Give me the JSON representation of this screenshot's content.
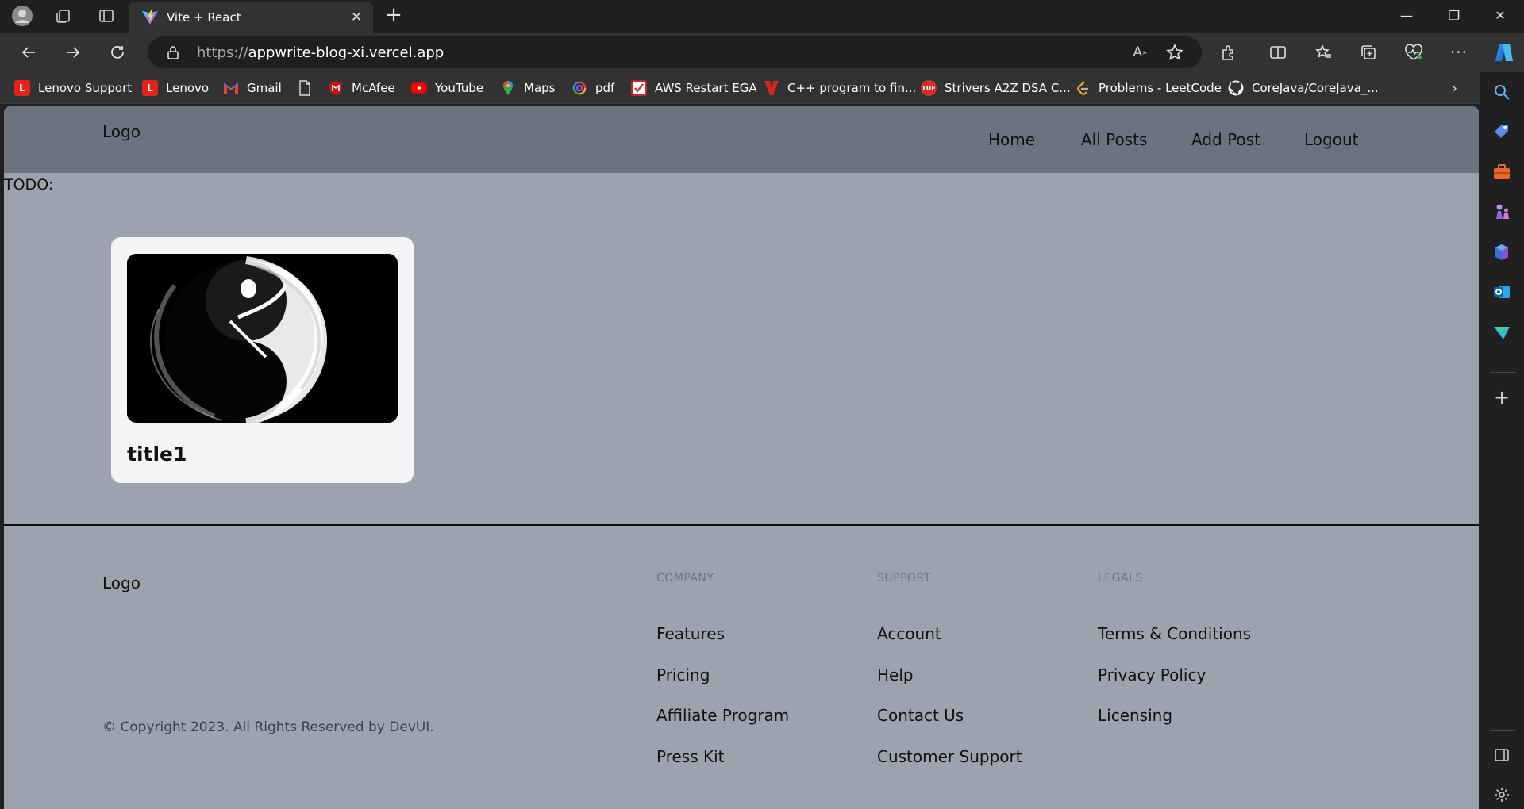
{
  "browser": {
    "tab_title": "Vite + React",
    "url_protocol": "https://",
    "url_host": "appwrite-blog-xi.vercel.app",
    "bookmarks": [
      {
        "label": "Lenovo Support",
        "icon": "lenovo-icon",
        "color": "#e2231a",
        "glyph": "L"
      },
      {
        "label": "Lenovo",
        "icon": "lenovo-icon",
        "color": "#e2231a",
        "glyph": "L"
      },
      {
        "label": "Gmail",
        "icon": "gmail-icon",
        "color": "#323232",
        "glyph": "M"
      },
      {
        "label": "",
        "icon": "page-icon",
        "color": "#323232",
        "glyph": ""
      },
      {
        "label": "McAfee",
        "icon": "mcafee-icon",
        "color": "#c01818",
        "glyph": "M"
      },
      {
        "label": "YouTube",
        "icon": "youtube-icon",
        "color": "#ff0000",
        "glyph": "▶"
      },
      {
        "label": "Maps",
        "icon": "maps-icon",
        "color": "#34a853",
        "glyph": "●"
      },
      {
        "label": "pdf",
        "icon": "pdf-icon",
        "color": "#6b4de6",
        "glyph": "◎"
      },
      {
        "label": "AWS Restart EGA",
        "icon": "check-icon",
        "color": "#c62828",
        "glyph": "✓"
      },
      {
        "label": "C++ program to fin...",
        "icon": "v-logo-icon",
        "color": "#323232",
        "glyph": "▼"
      },
      {
        "label": "Strivers A2Z DSA C...",
        "icon": "tuf-icon",
        "color": "#d32f2f",
        "glyph": "T"
      },
      {
        "label": "Problems - LeetCode",
        "icon": "leetcode-icon",
        "color": "#323232",
        "glyph": "‹"
      },
      {
        "label": "CoreJava/CoreJava_...",
        "icon": "github-icon",
        "color": "#323232",
        "glyph": "●"
      }
    ]
  },
  "site": {
    "header_logo": "Logo",
    "nav": [
      "Home",
      "All Posts",
      "Add Post",
      "Logout"
    ],
    "todo_text": "TODO:",
    "posts": [
      {
        "title": "title1",
        "image": "yin-yang-image"
      }
    ],
    "footer": {
      "logo": "Logo",
      "copyright": "© Copyright 2023. All Rights Reserved by DevUI.",
      "columns": [
        {
          "heading": "COMPANY",
          "links": [
            "Features",
            "Pricing",
            "Affiliate Program",
            "Press Kit"
          ]
        },
        {
          "heading": "SUPPORT",
          "links": [
            "Account",
            "Help",
            "Contact Us",
            "Customer Support"
          ]
        },
        {
          "heading": "LEGALS",
          "links": [
            "Terms & Conditions",
            "Privacy Policy",
            "Licensing"
          ]
        }
      ]
    }
  },
  "colors": {
    "header_bg": "#6b7280",
    "page_bg": "#9ca3af",
    "card_bg": "#f3f4f6",
    "browser_chrome": "#323232"
  }
}
